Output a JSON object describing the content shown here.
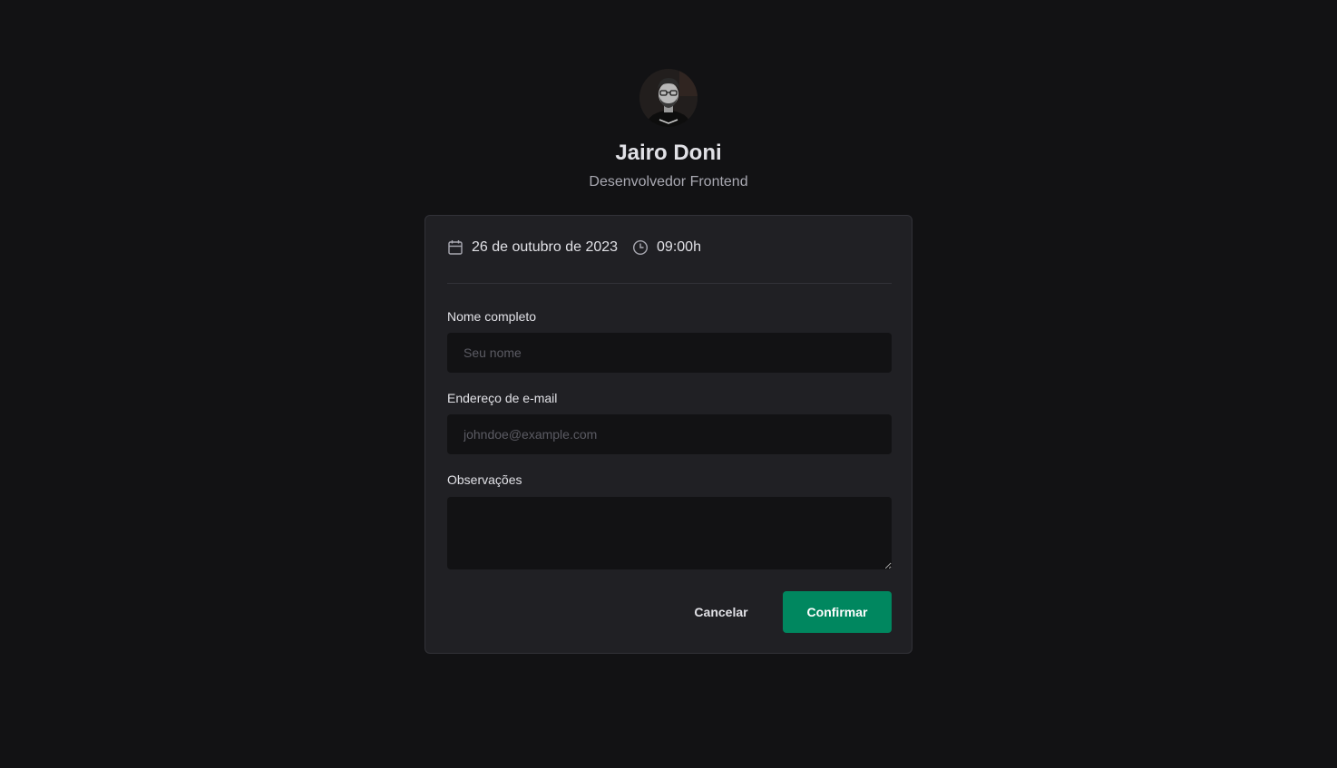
{
  "profile": {
    "name": "Jairo Doni",
    "role": "Desenvolvedor Frontend",
    "avatar_icon": "user-photo"
  },
  "schedule": {
    "date": "26 de outubro de 2023",
    "time": "09:00h",
    "date_icon": "calendar-icon",
    "time_icon": "clock-icon"
  },
  "form": {
    "name_label": "Nome completo",
    "name_placeholder": "Seu nome",
    "name_value": "",
    "email_label": "Endereço de e-mail",
    "email_placeholder": "johndoe@example.com",
    "email_value": "",
    "notes_label": "Observações",
    "notes_value": ""
  },
  "actions": {
    "cancel_label": "Cancelar",
    "confirm_label": "Confirmar"
  },
  "colors": {
    "background": "#121214",
    "card": "#202024",
    "input": "#121214",
    "accent": "#00875f",
    "text": "#e1e1e6",
    "muted": "#a9a9b2"
  }
}
